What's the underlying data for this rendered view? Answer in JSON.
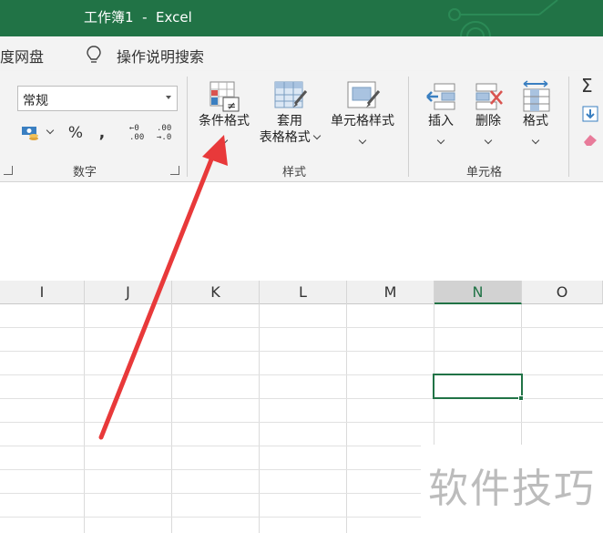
{
  "window": {
    "title": "工作簿1  -  Excel",
    "accent_color": "#217346"
  },
  "tellme": {
    "partial_left_label": "度网盘",
    "placeholder": "操作说明搜索",
    "icon": "lightbulb-icon"
  },
  "ribbon": {
    "number_group": {
      "label": "数字",
      "format_value": "常规",
      "percent_label": "%",
      "comma_label": ",",
      "increase_decimal_top": "←0",
      "increase_decimal_bottom": ".00",
      "decrease_decimal_top": ".00",
      "decrease_decimal_bottom": "→.0"
    },
    "styles_group": {
      "label": "样式",
      "conditional_formatting": "条件格式",
      "format_as_table_line1": "套用",
      "format_as_table_line2": "表格格式",
      "cell_styles": "单元格样式"
    },
    "cells_group": {
      "label": "单元格",
      "insert": "插入",
      "delete": "删除",
      "format": "格式"
    },
    "editing_group": {
      "autosum_icon": "sigma-icon",
      "fill_icon": "fill-down-icon",
      "clear_icon": "eraser-icon"
    }
  },
  "sheet": {
    "columns": [
      "I",
      "J",
      "K",
      "L",
      "M",
      "N",
      "O"
    ],
    "selected_column": "N",
    "active_cell_column": "N"
  },
  "annotation": {
    "arrow_color": "#e8393a"
  },
  "watermark": {
    "text": "软件技巧"
  }
}
